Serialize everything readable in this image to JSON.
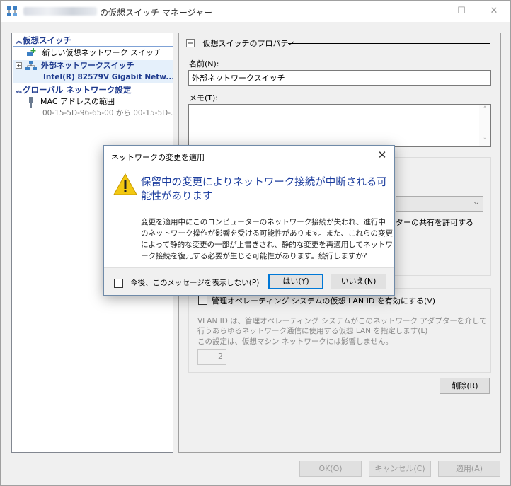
{
  "window": {
    "title": "の仮想スイッチ マネージャー",
    "minimize": "—",
    "maximize": "☐",
    "close": "✕"
  },
  "tree": {
    "virtual_switches_header": "仮想スイッチ",
    "new_switch": "新しい仮想ネットワーク スイッチ",
    "external_switch_name": "外部ネットワークスイッチ",
    "external_switch_adapter": "Intel(R) 82579V Gigabit Netw...",
    "global_header": "グローバル ネットワーク設定",
    "mac_range_label": "MAC アドレスの範囲",
    "mac_range_value": "00-15-5D-96-65-00 から 00-15-5D-..."
  },
  "properties": {
    "group_title": "仮想スイッチのプロパティ",
    "name_label": "名前(N):",
    "name_value": "外部ネットワークスイッチ",
    "memo_label": "メモ(T):",
    "memo_value": "",
    "scroll_up": "˄",
    "scroll_down": "˅",
    "conn_type_partial": "ターの共有を許可する",
    "vlan_checkbox_label": "管理オペレーティング システムの仮想 LAN ID を有効にする(V)",
    "vlan_description": "VLAN ID は、管理オペレーティング システムがこのネットワーク アダプターを介して行うあらゆるネットワーク通信に使用する仮想 LAN を指定します(L)",
    "vlan_note": "この設定は、仮想マシン ネットワークには影響しません。",
    "vlan_value": "2",
    "remove_button": "削除(R)"
  },
  "footer": {
    "ok": "OK(O)",
    "cancel": "キャンセル(C)",
    "apply": "適用(A)"
  },
  "dialog": {
    "title": "ネットワークの変更を適用",
    "close": "✕",
    "main_instruction": "保留中の変更によりネットワーク接続が中断される可能性があります",
    "body": "変更を適用中にこのコンピューターのネットワーク接続が失われ、進行中のネットワーク操作が影響を受ける可能性があります。また、これらの変更によって静的な変更の一部が上書きされ、静的な変更を再適用してネットワーク接続を復元する必要が生じる可能性があります。続行しますか?",
    "dont_show_label": "今後、このメッセージを表示しない(P)",
    "yes": "はい(Y)",
    "no": "いいえ(N)"
  },
  "colors": {
    "accent": "#0078d7",
    "header_text": "#1f3b8f",
    "main_instruction": "#1c3d9e",
    "warning": "#f2c811"
  }
}
